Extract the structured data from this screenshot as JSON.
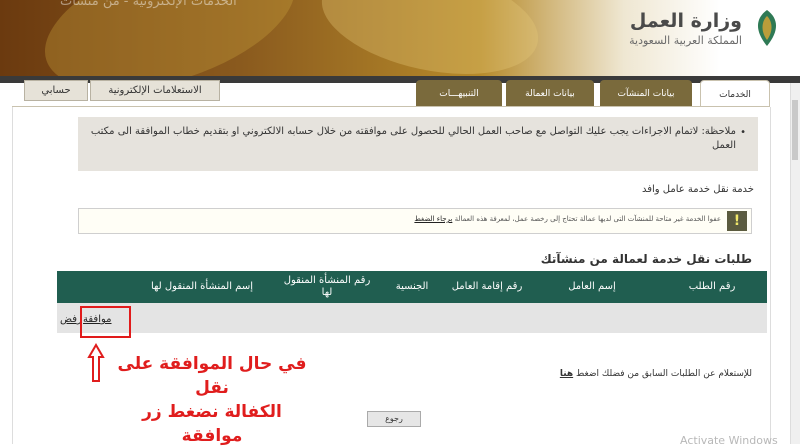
{
  "header": {
    "ministry": "وزارة العمل",
    "kingdom": "المملكة العربية السعودية",
    "faded_text": "الخدمات الإلكترونية - من منشآت"
  },
  "top_buttons": {
    "account": "حسابي",
    "e_inquiries": "الاستعلامات الإلكترونية"
  },
  "tabs": {
    "services": "الخدمات",
    "establishments": "بيانات المنشآت",
    "labor": "بيانات العمالة",
    "alerts": "التنبيهـــات"
  },
  "note": {
    "text": "ملاحظة: لاتمام الاجراءات يجب عليك التواصل مع صاحب العمل الحالي للحصول على موافقته من خلال حسابه الالكتروني او بتقديم خطاب الموافقة الى مكتب العمل"
  },
  "service_title": "خدمة نقل خدمة عامل وافد",
  "warning": {
    "text": "عفوا الخدمة غير متاحة للمنشآت التى لديها عمالة تحتاج إلى رخصة عمل، لمعرفة هذه العمالة",
    "link": "برجاء الضغط"
  },
  "section_title": "طلبات نقل خدمة لعمالة من منشآتك",
  "table": {
    "headers": [
      "رقم الطلب",
      "إسم العامل",
      "رقم إقامة العامل",
      "الجنسية",
      "رقم المنشأة المنقول لها",
      "إسم المنشأة المنقول لها"
    ],
    "actions": {
      "approve": "موافقة",
      "reject": "رفض"
    }
  },
  "annotation": {
    "line1": "في حال الموافقة على نقل",
    "line2": "الكفالة نضغط زر موافقة"
  },
  "inquiry": {
    "text": "للإستعلام عن الطلبات السابق من فضلك اضغط",
    "link": "هنا"
  },
  "back_button": "رجوع",
  "watermark": "Activate Windows"
}
